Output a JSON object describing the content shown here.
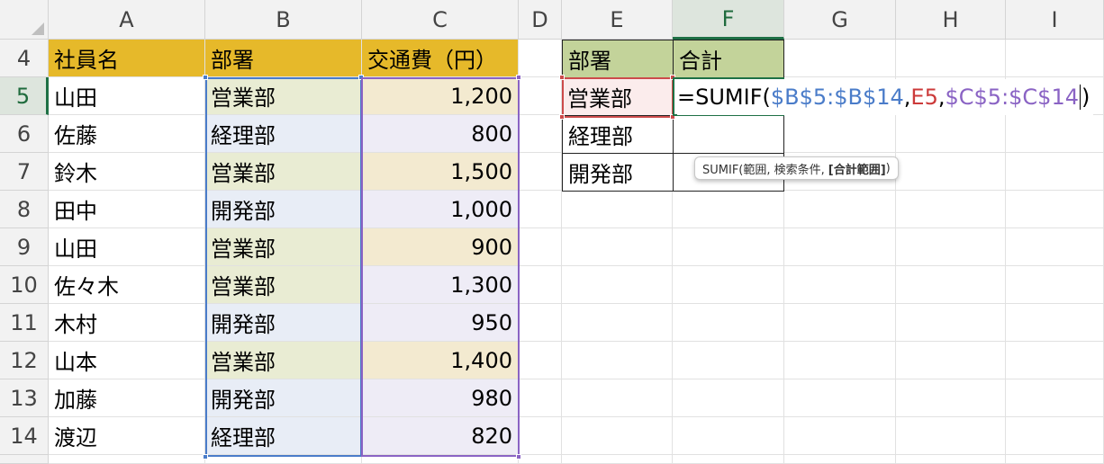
{
  "columns": [
    {
      "label": "A"
    },
    {
      "label": "B"
    },
    {
      "label": "C"
    },
    {
      "label": "D"
    },
    {
      "label": "E"
    },
    {
      "label": "F"
    },
    {
      "label": "G"
    },
    {
      "label": "H"
    },
    {
      "label": "I"
    }
  ],
  "rows": [
    "4",
    "5",
    "6",
    "7",
    "8",
    "9",
    "10",
    "11",
    "12",
    "13",
    "14"
  ],
  "headers": {
    "name": "社員名",
    "dept": "部署",
    "cost": "交通費（円）",
    "summary_dept": "部署",
    "summary_total": "合計"
  },
  "records": [
    {
      "name": "山田",
      "dept": "営業部",
      "cost": "1,200"
    },
    {
      "name": "佐藤",
      "dept": "経理部",
      "cost": "800"
    },
    {
      "name": "鈴木",
      "dept": "営業部",
      "cost": "1,500"
    },
    {
      "name": "田中",
      "dept": "開発部",
      "cost": "1,000"
    },
    {
      "name": "山田",
      "dept": "営業部",
      "cost": "900"
    },
    {
      "name": "佐々木",
      "dept": "営業部",
      "cost": "1,300"
    },
    {
      "name": "木村",
      "dept": "開発部",
      "cost": "950"
    },
    {
      "name": "山本",
      "dept": "営業部",
      "cost": "1,400"
    },
    {
      "name": "加藤",
      "dept": "開発部",
      "cost": "980"
    },
    {
      "name": "渡辺",
      "dept": "経理部",
      "cost": "820"
    }
  ],
  "summary": [
    {
      "dept": "営業部"
    },
    {
      "dept": "経理部"
    },
    {
      "dept": "開発部"
    }
  ],
  "formula": {
    "prefix": "=SUMIF(",
    "range": "$B$5:$B$14",
    "sep1": ",",
    "criteria": "E5",
    "sep2": ",",
    "sum_range": "$C$5:$C$14",
    "suffix": ")"
  },
  "tooltip": {
    "text": "SUMIF(範囲, 検索条件,",
    "bold": "[合計範囲]",
    "end": ")"
  },
  "active_column": "F",
  "active_row": "5",
  "colors": {
    "header_gold": "#e6b92a",
    "header_green": "#c3d39a",
    "range_blue": "#4a7cc9",
    "range_purple": "#8a63c4",
    "range_red": "#cc4b4b",
    "active_green": "#1e7145"
  }
}
